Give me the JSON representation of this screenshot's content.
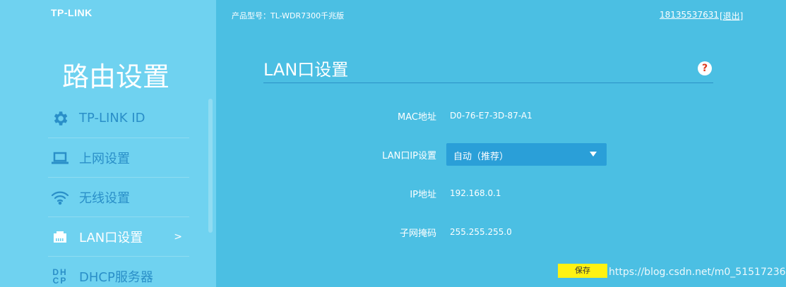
{
  "brand": {
    "logo_text": "TP-LINK"
  },
  "header": {
    "model_label": "产品型号：TL-WDR7300千兆版",
    "account": "18135537631",
    "logout": "[退出]"
  },
  "sidebar": {
    "title": "路由设置",
    "items": [
      {
        "label": "TP-LINK ID",
        "icon": "gear-icon",
        "active": false
      },
      {
        "label": "上网设置",
        "icon": "laptop-icon",
        "active": false
      },
      {
        "label": "无线设置",
        "icon": "wifi-icon",
        "active": false
      },
      {
        "label": "LAN口设置",
        "icon": "lan-port-icon",
        "active": true,
        "arrow": ">"
      },
      {
        "label": "DHCP服务器",
        "icon": "dhcp-icon",
        "icon_text": "DHCP",
        "active": false
      }
    ]
  },
  "main": {
    "section_title": "LAN口设置",
    "help_symbol": "?",
    "fields": {
      "mac_label": "MAC地址",
      "mac_value": "D0-76-E7-3D-87-A1",
      "mode_label": "LAN口IP设置",
      "mode_value": "自动（推荐）",
      "ip_label": "IP地址",
      "ip_value": "192.168.0.1",
      "mask_label": "子网掩码",
      "mask_value": "255.255.255.0"
    },
    "save_label": "保存"
  },
  "watermark": "https://blog.csdn.net/m0_51517236",
  "colors": {
    "sidebar_bg": "#6fd2f0",
    "main_bg": "#4bbfe3",
    "accent_text": "#2a8fc8",
    "select_bg": "#2a9fd8",
    "save_button": "#fff212"
  }
}
